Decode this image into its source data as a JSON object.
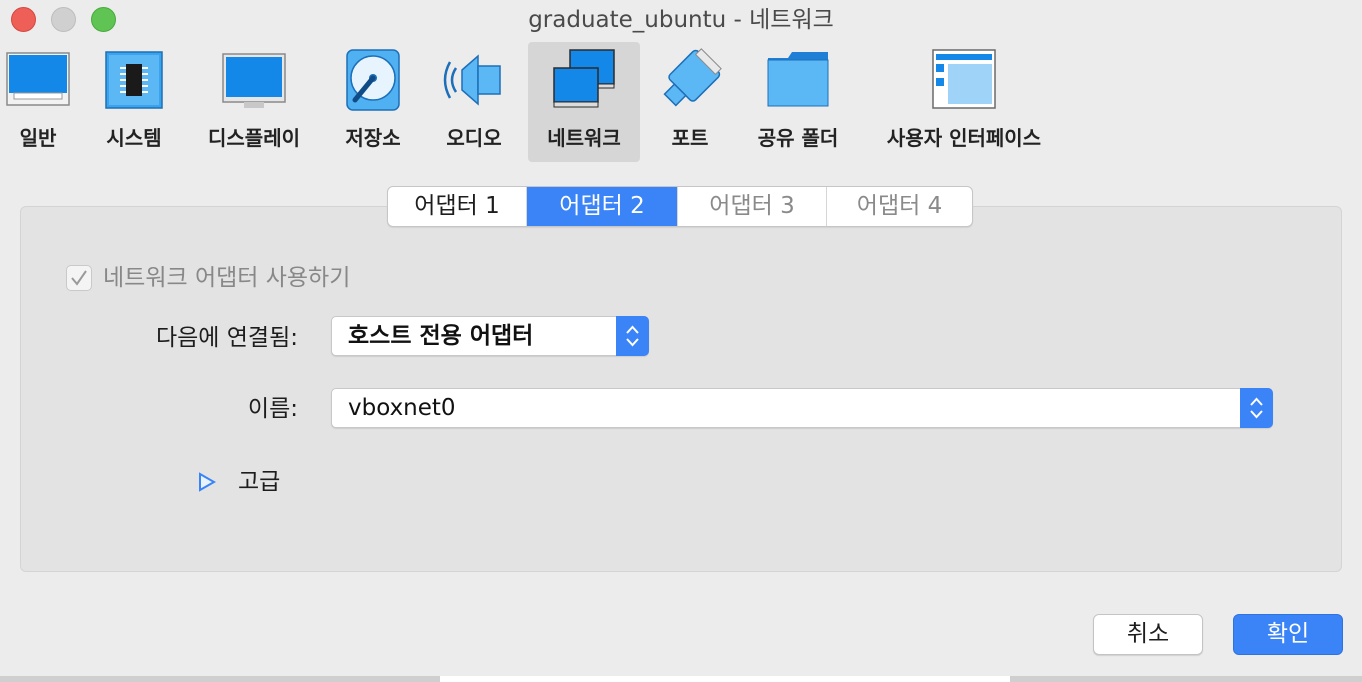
{
  "window": {
    "title": "graduate_ubuntu - 네트워크"
  },
  "toolbar": {
    "items": [
      {
        "label": "일반",
        "icon": "general-icon"
      },
      {
        "label": "시스템",
        "icon": "system-chip-icon"
      },
      {
        "label": "디스플레이",
        "icon": "display-monitor-icon"
      },
      {
        "label": "저장소",
        "icon": "storage-disk-icon"
      },
      {
        "label": "오디오",
        "icon": "audio-speaker-icon"
      },
      {
        "label": "네트워크",
        "icon": "network-icon",
        "selected": true
      },
      {
        "label": "포트",
        "icon": "ports-connector-icon"
      },
      {
        "label": "공유 폴더",
        "icon": "shared-folder-icon"
      },
      {
        "label": "사용자 인터페이스",
        "icon": "user-interface-icon"
      }
    ]
  },
  "tabs": [
    {
      "label": "어댑터 1",
      "state": "normal"
    },
    {
      "label": "어댑터 2",
      "state": "selected"
    },
    {
      "label": "어댑터 3",
      "state": "disabled"
    },
    {
      "label": "어댑터 4",
      "state": "disabled"
    }
  ],
  "adapter": {
    "enable_label": "네트워크 어댑터 사용하기",
    "enable_checked": true,
    "attached_label": "다음에 연결됨:",
    "attached_value": "호스트 전용 어댑터",
    "name_label": "이름:",
    "name_value": "vboxnet0",
    "advanced_label": "고급"
  },
  "buttons": {
    "cancel": "취소",
    "ok": "확인"
  },
  "colors": {
    "accent": "#3a84f7",
    "icon_blue": "#1e88e5",
    "selected_toolbar_bg": "#d6d6d6"
  }
}
